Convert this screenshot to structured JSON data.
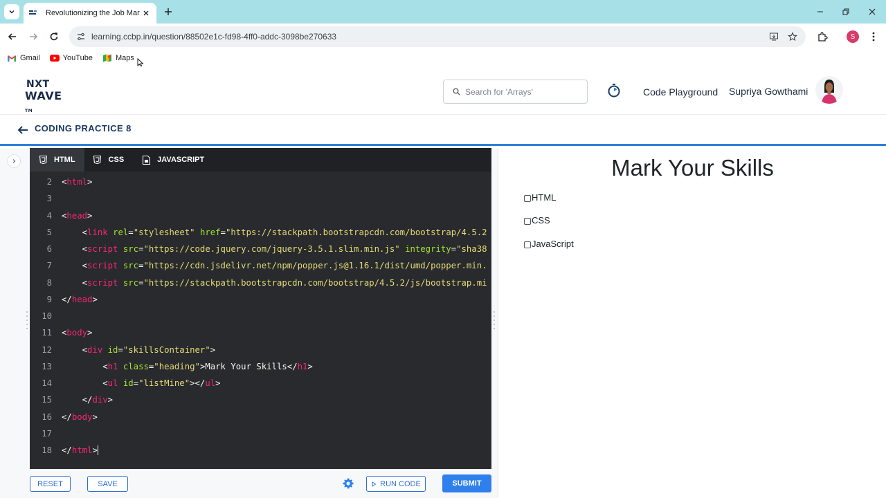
{
  "browser": {
    "tab_title": "Revolutionizing the Job Market",
    "url": "learning.ccbp.in/question/88502e1c-fd98-4ff0-addc-3098be270633",
    "profile_initial": "S",
    "bookmarks": [
      {
        "label": "Gmail",
        "icon": "gmail-icon"
      },
      {
        "label": "YouTube",
        "icon": "youtube-icon"
      },
      {
        "label": "Maps",
        "icon": "maps-icon"
      }
    ]
  },
  "header": {
    "logo_line1": "NXT",
    "logo_line2": "WAVE",
    "logo_tm": "TM",
    "search_placeholder": "Search for 'Arrays'",
    "code_playground": "Code Playground",
    "username": "Supriya Gowthami"
  },
  "subheader": {
    "title": "CODING PRACTICE 8"
  },
  "editor": {
    "tabs": [
      "HTML",
      "CSS",
      "JAVASCRIPT"
    ],
    "active_tab": "HTML",
    "line_numbers": [
      "2",
      "3",
      "4",
      "5",
      "6",
      "7",
      "8",
      "9",
      "10",
      "11",
      "12",
      "13",
      "14",
      "15",
      "16",
      "17",
      "18"
    ],
    "buttons": {
      "reset": "RESET",
      "save": "SAVE",
      "run": "RUN CODE",
      "submit": "SUBMIT"
    }
  },
  "preview": {
    "heading": "Mark Your Skills",
    "skills": [
      "HTML",
      "CSS",
      "JavaScript"
    ]
  },
  "colors": {
    "accent": "#2f80ed",
    "title_blue": "#1b3a66",
    "tabstrip": "#a8e0e8",
    "editor_bg": "#282a2e"
  }
}
